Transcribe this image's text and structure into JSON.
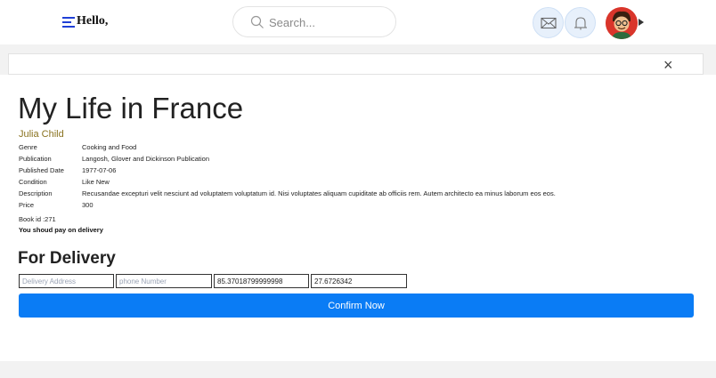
{
  "header": {
    "greeting": "Hello,",
    "search_placeholder": "Search...",
    "icons": [
      "menu-icon",
      "search-icon",
      "mail-icon",
      "bell-icon",
      "avatar"
    ]
  },
  "modal": {
    "close_label": "×",
    "book": {
      "title": "My Life in France",
      "author": "Julia Child",
      "details": [
        {
          "label": "Genre",
          "value": "Cooking and Food"
        },
        {
          "label": "Publication",
          "value": "Langosh, Glover and Dickinson Publication"
        },
        {
          "label": "Published Date",
          "value": "1977-07-06"
        },
        {
          "label": "Condition",
          "value": "Like New"
        },
        {
          "label": "Description",
          "value": "Recusandae excepturi velit nesciunt ad voluptatem voluptatum id. Nisi voluptates aliquam cupiditate ab officiis rem. Autem architecto ea minus laborum eos eos."
        },
        {
          "label": "Price",
          "value": "300"
        }
      ],
      "book_id": "Book id :271",
      "payment_note": "You shoud pay on delivery"
    },
    "delivery": {
      "heading": "For Delivery",
      "address_placeholder": "Delivery Address",
      "phone_placeholder": "phone Number",
      "latitude": "85.37018799999998",
      "longitude": "27.6726342",
      "confirm_label": "Confirm Now"
    }
  },
  "colors": {
    "accent": "#0a7cf5",
    "author": "#8a7320",
    "menu": "#1f3fd6"
  }
}
